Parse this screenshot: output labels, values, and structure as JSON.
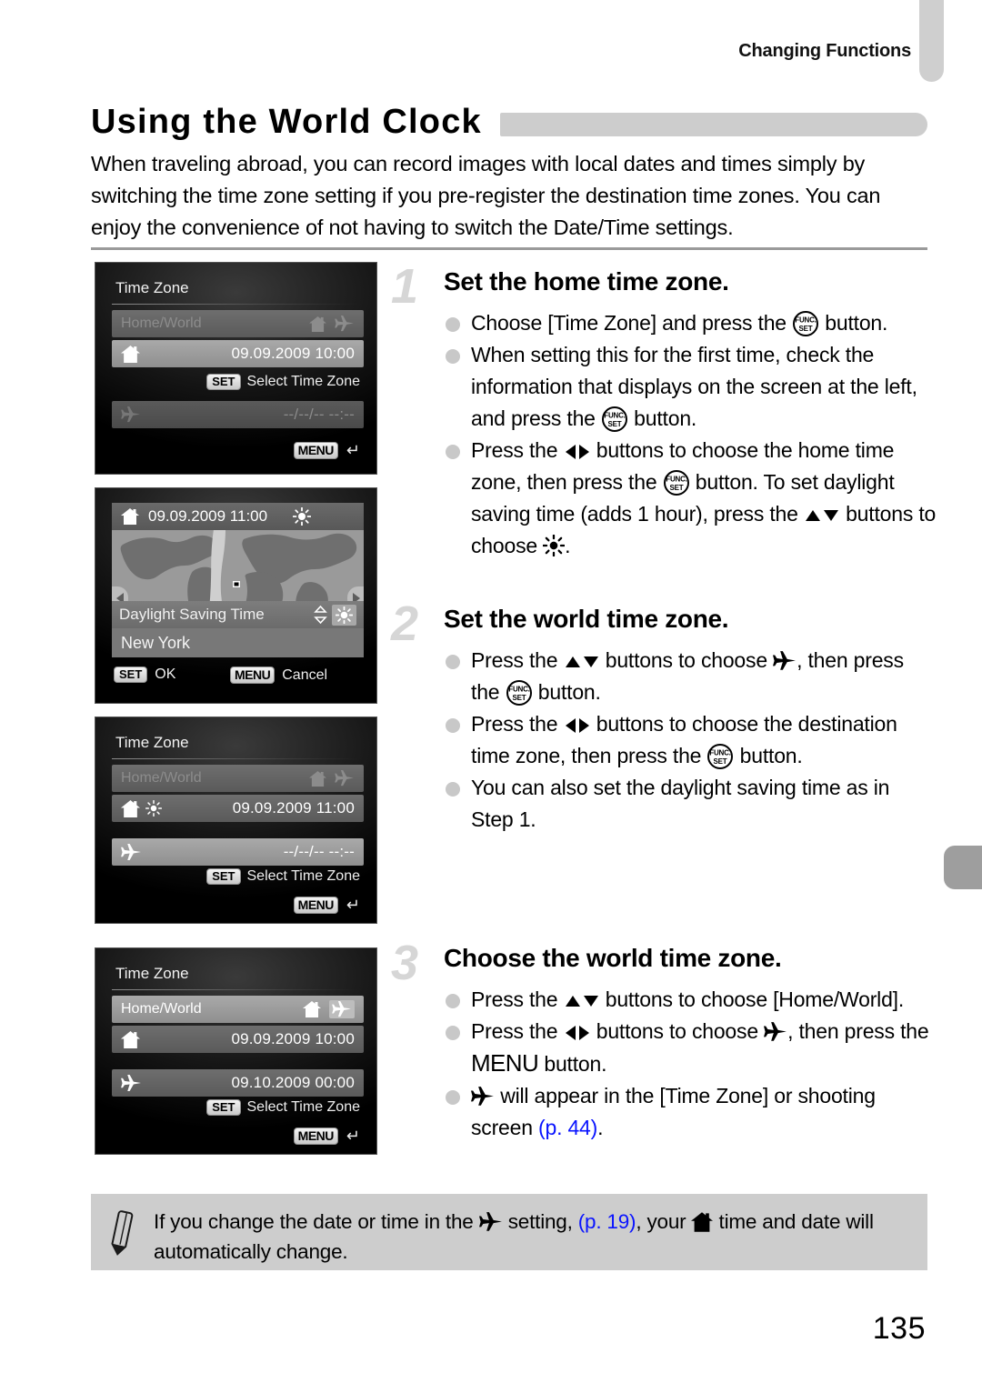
{
  "header": {
    "running_head": "Changing Functions"
  },
  "title": {
    "text": "Using the World Clock"
  },
  "intro": {
    "text": "When traveling abroad, you can record images with local dates and times simply by switching the time zone setting if you pre-register the destination time zones. You can enjoy the convenience of not having to switch the Date/Time settings."
  },
  "screens": [
    {
      "id": "time-zone-home",
      "title": "Time Zone",
      "rows": [
        {
          "label": "Home/World",
          "icons": [
            "home-icon",
            "airplane-icon"
          ],
          "state": "dim"
        },
        {
          "label": "",
          "icons": [
            "home-icon"
          ],
          "value": "09.09.2009 10:00",
          "state": "selected"
        },
        {
          "label": "",
          "icons": [
            "airplane-icon"
          ],
          "value": "--/--/-- --:--",
          "state": "dim"
        }
      ],
      "hint_set": {
        "key": "SET",
        "text": "Select Time Zone"
      },
      "hint_menu": {
        "key": "MENU",
        "text": ""
      }
    },
    {
      "id": "world-map",
      "time": "09.09.2009 11:00",
      "dst_label": "Daylight Saving Time",
      "city": "New York",
      "footer_set": {
        "key": "SET",
        "text": "OK"
      },
      "footer_menu": {
        "key": "MENU",
        "text": "Cancel"
      }
    },
    {
      "id": "time-zone-dst",
      "title": "Time Zone",
      "rows": [
        {
          "label": "Home/World",
          "icons": [
            "home-icon",
            "airplane-icon"
          ],
          "state": "dim"
        },
        {
          "label": "",
          "icons": [
            "home-icon",
            "sun-icon"
          ],
          "value": "09.09.2009 11:00",
          "state": "dim"
        },
        {
          "label": "",
          "icons": [
            "airplane-icon"
          ],
          "value": "--/--/-- --:--",
          "state": "selected"
        }
      ],
      "hint_set": {
        "key": "SET",
        "text": "Select Time Zone"
      },
      "hint_menu": {
        "key": "MENU",
        "text": ""
      }
    },
    {
      "id": "time-zone-world",
      "title": "Time Zone",
      "rows": [
        {
          "label": "Home/World",
          "icons": [
            "home-icon",
            "airplane-icon-boxed"
          ],
          "state": "selected"
        },
        {
          "label": "",
          "icons": [
            "home-icon"
          ],
          "value": "09.09.2009 10:00",
          "state": "dim"
        },
        {
          "label": "",
          "icons": [
            "airplane-icon"
          ],
          "value": "09.10.2009 00:00",
          "state": "dim"
        }
      ],
      "hint_set": {
        "key": "SET",
        "text": "Select Time Zone"
      },
      "hint_menu": {
        "key": "MENU",
        "text": ""
      }
    }
  ],
  "steps": [
    {
      "number": "1",
      "title": "Set the home time zone.",
      "bullets": [
        {
          "parts": [
            {
              "t": "text",
              "v": "Choose [Time Zone] and press the "
            },
            {
              "t": "icon",
              "v": "func-set-icon"
            },
            {
              "t": "text",
              "v": " button."
            }
          ]
        },
        {
          "parts": [
            {
              "t": "text",
              "v": "When setting this for the first time, check the information that displays on the screen at the left, and press the "
            },
            {
              "t": "icon",
              "v": "func-set-icon"
            },
            {
              "t": "text",
              "v": " button."
            }
          ]
        },
        {
          "parts": [
            {
              "t": "text",
              "v": "Press the "
            },
            {
              "t": "icon",
              "v": "left-right-icon"
            },
            {
              "t": "text",
              "v": " buttons to choose the home time zone, then press the "
            },
            {
              "t": "icon",
              "v": "func-set-icon"
            },
            {
              "t": "text",
              "v": " button. To set daylight saving time (adds 1 hour), press the "
            },
            {
              "t": "icon",
              "v": "up-down-icon"
            },
            {
              "t": "text",
              "v": " buttons to choose "
            },
            {
              "t": "icon",
              "v": "sun-icon"
            },
            {
              "t": "text",
              "v": "."
            }
          ]
        }
      ]
    },
    {
      "number": "2",
      "title": "Set the world time zone.",
      "bullets": [
        {
          "parts": [
            {
              "t": "text",
              "v": "Press the "
            },
            {
              "t": "icon",
              "v": "up-down-icon"
            },
            {
              "t": "text",
              "v": " buttons to choose "
            },
            {
              "t": "icon",
              "v": "airplane-icon"
            },
            {
              "t": "text",
              "v": ", then press the "
            },
            {
              "t": "icon",
              "v": "func-set-icon"
            },
            {
              "t": "text",
              "v": " button."
            }
          ]
        },
        {
          "parts": [
            {
              "t": "text",
              "v": "Press the "
            },
            {
              "t": "icon",
              "v": "left-right-icon"
            },
            {
              "t": "text",
              "v": " buttons to choose the destination time zone, then press the "
            },
            {
              "t": "icon",
              "v": "func-set-icon"
            },
            {
              "t": "text",
              "v": " button."
            }
          ]
        },
        {
          "parts": [
            {
              "t": "text",
              "v": "You can also set the daylight saving time as in Step 1."
            }
          ]
        }
      ]
    },
    {
      "number": "3",
      "title": "Choose the world time zone.",
      "bullets": [
        {
          "parts": [
            {
              "t": "text",
              "v": "Press the "
            },
            {
              "t": "icon",
              "v": "up-down-icon"
            },
            {
              "t": "text",
              "v": " buttons to choose [Home/World]."
            }
          ]
        },
        {
          "parts": [
            {
              "t": "text",
              "v": "Press the "
            },
            {
              "t": "icon",
              "v": "left-right-icon"
            },
            {
              "t": "text",
              "v": " buttons to choose "
            },
            {
              "t": "icon",
              "v": "airplane-icon"
            },
            {
              "t": "text",
              "v": ", then press the "
            },
            {
              "t": "menu",
              "v": "MENU"
            },
            {
              "t": "text",
              "v": " button."
            }
          ]
        },
        {
          "parts": [
            {
              "t": "icon",
              "v": "airplane-icon"
            },
            {
              "t": "text",
              "v": " will appear in the [Time Zone] or shooting screen "
            },
            {
              "t": "ref",
              "v": "(p. 44)"
            },
            {
              "t": "text",
              "v": "."
            }
          ]
        }
      ]
    }
  ],
  "note": {
    "icon": "pencil-icon",
    "parts": [
      {
        "t": "text",
        "v": "If you change the date or time in the "
      },
      {
        "t": "icon",
        "v": "airplane-icon"
      },
      {
        "t": "text",
        "v": " setting, "
      },
      {
        "t": "ref",
        "v": "(p. 19)"
      },
      {
        "t": "text",
        "v": ", your "
      },
      {
        "t": "icon",
        "v": "home-icon"
      },
      {
        "t": "text",
        "v": " time and date will automatically change."
      }
    ]
  },
  "footer": {
    "page_number": "135"
  },
  "colors": {
    "reference_link": "#0a14ff",
    "title_bar": "#cdcdcd",
    "note_bg": "#cdcdcd",
    "step_number": "#d6d6d6",
    "bullet": "#c8c8c8"
  }
}
